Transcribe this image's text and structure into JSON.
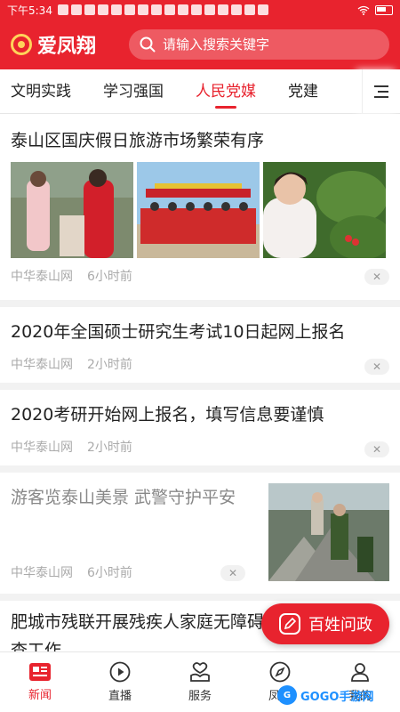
{
  "status_bar": {
    "time": "下午5:34"
  },
  "header": {
    "app_name": "爱凤翔",
    "search_placeholder": "请输入搜索关键字"
  },
  "tabs": [
    {
      "label": "文明实践",
      "active": false
    },
    {
      "label": "学习强国",
      "active": false
    },
    {
      "label": "人民党媒",
      "active": true
    },
    {
      "label": "党建",
      "active": false
    }
  ],
  "feed": [
    {
      "title": "泰山区国庆假日旅游市场繁荣有序",
      "source": "中华泰山网",
      "time": "6小时前"
    },
    {
      "title": "2020年全国硕士研究生考试10日起网上报名",
      "source": "中华泰山网",
      "time": "2小时前"
    },
    {
      "title": "2020考研开始网上报名，填写信息要谨慎",
      "source": "中华泰山网",
      "time": "2小时前"
    },
    {
      "title": "游客览泰山美景 武警守护平安",
      "source": "中华泰山网",
      "time": "6小时前"
    },
    {
      "title": "肥城市残联开展残疾人家庭无障碍改造专项调研督查工作"
    }
  ],
  "float_button": {
    "label": "百姓问政"
  },
  "bottom_nav": [
    {
      "label": "新闻",
      "icon": "news-icon",
      "active": true
    },
    {
      "label": "直播",
      "icon": "play-icon",
      "active": false
    },
    {
      "label": "服务",
      "icon": "service-icon",
      "active": false
    },
    {
      "label": "凤翔",
      "icon": "compass-icon",
      "active": false
    },
    {
      "label": "我的",
      "icon": "user-icon",
      "active": false
    }
  ],
  "watermark": {
    "text": "GOGO手游网"
  },
  "colors": {
    "brand_red": "#e8232e",
    "meta_grey": "#aaaaaa"
  }
}
